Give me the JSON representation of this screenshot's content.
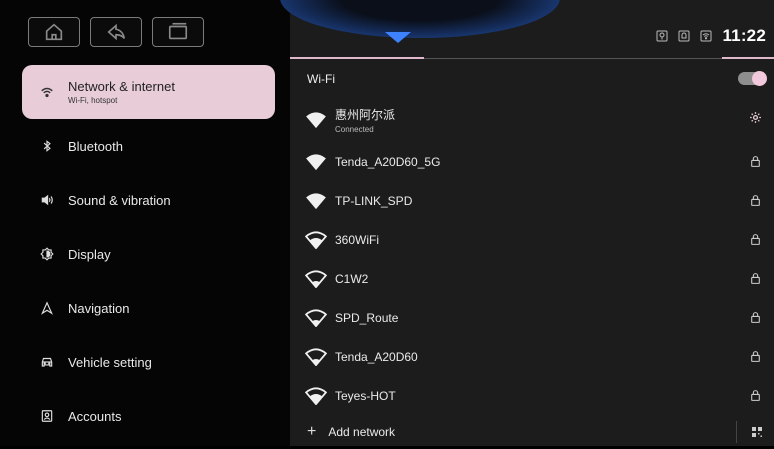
{
  "colors": {
    "accent": "#e8ccd8",
    "blue": "#3e82ff"
  },
  "navigation_buttons": [
    {
      "icon": "home-icon"
    },
    {
      "icon": "back-icon"
    },
    {
      "icon": "recent-apps-icon"
    }
  ],
  "sidebar": {
    "items": [
      {
        "label": "Network & internet",
        "sub": "Wi-Fi, hotspot",
        "icon": "wifi-icon",
        "active": true
      },
      {
        "label": "Bluetooth",
        "icon": "bluetooth-icon"
      },
      {
        "label": "Sound & vibration",
        "icon": "volume-icon"
      },
      {
        "label": "Display",
        "icon": "display-icon"
      },
      {
        "label": "Navigation",
        "icon": "navigation-icon"
      },
      {
        "label": "Vehicle setting",
        "icon": "car-icon"
      },
      {
        "label": "Accounts",
        "icon": "account-icon"
      }
    ]
  },
  "status_bar": {
    "time": "11:22",
    "icons": [
      "location-icon",
      "notification-icon",
      "wifi-status-icon"
    ]
  },
  "wifi": {
    "header": "Wi-Fi",
    "toggle_on": true,
    "networks": [
      {
        "name": "惠州阿尔派",
        "status": "Connected",
        "trailing": "settings-icon",
        "strength": "full"
      },
      {
        "name": "Tenda_A20D60_5G",
        "trailing": "lock-icon",
        "strength": "full"
      },
      {
        "name": "TP-LINK_SPD",
        "trailing": "lock-icon",
        "strength": "full"
      },
      {
        "name": "360WiFi",
        "trailing": "lock-icon",
        "strength": "medium"
      },
      {
        "name": "C1W2",
        "trailing": "lock-icon",
        "strength": "low"
      },
      {
        "name": "SPD_Route",
        "trailing": "lock-icon",
        "strength": "low"
      },
      {
        "name": "Tenda_A20D60",
        "trailing": "lock-icon",
        "strength": "low"
      },
      {
        "name": "Teyes-HOT",
        "trailing": "lock-icon",
        "strength": "medium"
      }
    ],
    "add_network": "Add network"
  }
}
